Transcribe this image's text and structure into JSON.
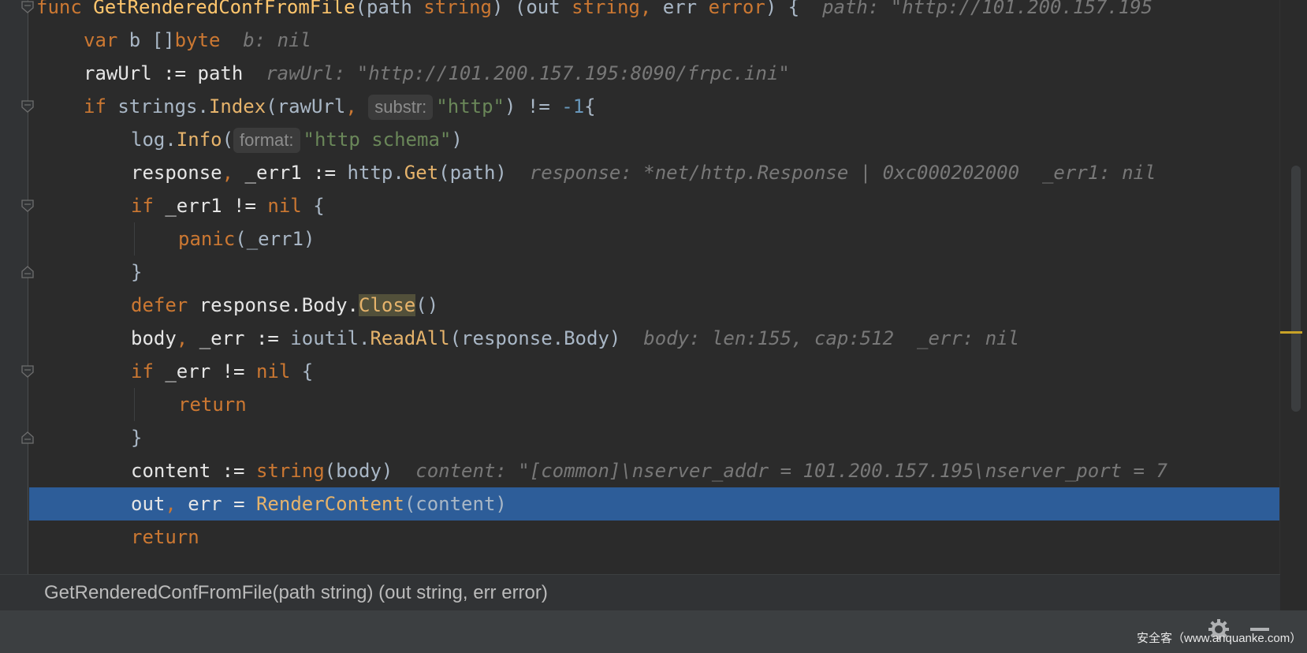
{
  "editor": {
    "lines": [
      {
        "parts": [
          [
            "kw",
            "func "
          ],
          [
            "fn",
            "GetRenderedConfFromFile"
          ],
          [
            "plain",
            "(path "
          ],
          [
            "kw",
            "string"
          ],
          [
            "plain",
            ") (out "
          ],
          [
            "kw",
            "string"
          ],
          [
            "kw",
            ", "
          ],
          [
            "plain",
            "err "
          ],
          [
            "kw",
            "error"
          ],
          [
            "plain",
            ") {  "
          ],
          [
            "hint",
            "path: \"http://101.200.157.195"
          ]
        ]
      },
      {
        "parts": [
          [
            "kw",
            "var "
          ],
          [
            "plain",
            "b []"
          ],
          [
            "kw",
            "byte"
          ],
          [
            "plain",
            "  "
          ],
          [
            "hint",
            "b: nil"
          ]
        ]
      },
      {
        "parts": [
          [
            "ident",
            "rawUrl := path  "
          ],
          [
            "hint",
            "rawUrl: \"http://101.200.157.195:8090/frpc.ini\""
          ]
        ]
      },
      {
        "parts": [
          [
            "kw",
            "if "
          ],
          [
            "pkg",
            "strings."
          ],
          [
            "call",
            "Index"
          ],
          [
            "plain",
            "(rawUrl"
          ],
          [
            "kw",
            ", "
          ],
          [
            "param",
            "substr:"
          ],
          [
            "str",
            "\"http\""
          ],
          [
            "plain",
            ") != "
          ],
          [
            "num",
            "-1"
          ],
          [
            "plain",
            "{"
          ]
        ]
      },
      {
        "parts": [
          [
            "pkg",
            "log."
          ],
          [
            "call",
            "Info"
          ],
          [
            "plain",
            "("
          ],
          [
            "param",
            "format:"
          ],
          [
            "str",
            "\"http schema\""
          ],
          [
            "plain",
            ")"
          ]
        ]
      },
      {
        "parts": [
          [
            "ident",
            "response"
          ],
          [
            "kw",
            ", "
          ],
          [
            "ident",
            "_err1 := "
          ],
          [
            "pkg",
            "http."
          ],
          [
            "call",
            "Get"
          ],
          [
            "plain",
            "(path)  "
          ],
          [
            "hint",
            "response: *net/http.Response | 0xc000202000  _err1: nil"
          ]
        ]
      },
      {
        "parts": [
          [
            "kw",
            "if "
          ],
          [
            "ident",
            "_err1 != "
          ],
          [
            "kw",
            "nil "
          ],
          [
            "plain",
            "{"
          ]
        ]
      },
      {
        "parts": [
          [
            "kw",
            "panic"
          ],
          [
            "plain",
            "(_err1)"
          ]
        ]
      },
      {
        "parts": [
          [
            "plain",
            "}"
          ]
        ]
      },
      {
        "parts": [
          [
            "kw",
            "defer "
          ],
          [
            "ident",
            "response.Body."
          ],
          [
            "closehl",
            "Close"
          ],
          [
            "plain",
            "()"
          ]
        ]
      },
      {
        "parts": [
          [
            "ident",
            "body"
          ],
          [
            "kw",
            ", "
          ],
          [
            "ident",
            "_err := "
          ],
          [
            "pkg",
            "ioutil."
          ],
          [
            "call",
            "ReadAll"
          ],
          [
            "plain",
            "(response.Body)  "
          ],
          [
            "hint",
            "body: len:155, cap:512  _err: nil"
          ]
        ]
      },
      {
        "parts": [
          [
            "kw",
            "if "
          ],
          [
            "ident",
            "_err != "
          ],
          [
            "kw",
            "nil "
          ],
          [
            "plain",
            "{"
          ]
        ]
      },
      {
        "parts": [
          [
            "kw",
            "return"
          ]
        ]
      },
      {
        "parts": [
          [
            "plain",
            "}"
          ]
        ]
      },
      {
        "parts": [
          [
            "ident",
            "content := "
          ],
          [
            "kw",
            "string"
          ],
          [
            "plain",
            "(body)  "
          ],
          [
            "hint",
            "content: \"[common]\\nserver_addr = 101.200.157.195\\nserver_port = 7"
          ]
        ]
      },
      {
        "parts": [
          [
            "ident",
            "out"
          ],
          [
            "kw",
            ", "
          ],
          [
            "ident",
            "err = "
          ],
          [
            "call",
            "RenderContent"
          ],
          [
            "plain",
            "(content)"
          ]
        ]
      },
      {
        "parts": [
          [
            "kw",
            "return"
          ]
        ]
      }
    ]
  },
  "breadcrumb": {
    "text": "GetRenderedConfFromFile(path string) (out string, err error)"
  },
  "watermark": {
    "text": "安全客（www.anquanke.com）"
  },
  "icons": {
    "settings": "gear-icon",
    "panel": "hide-panel-icon"
  }
}
